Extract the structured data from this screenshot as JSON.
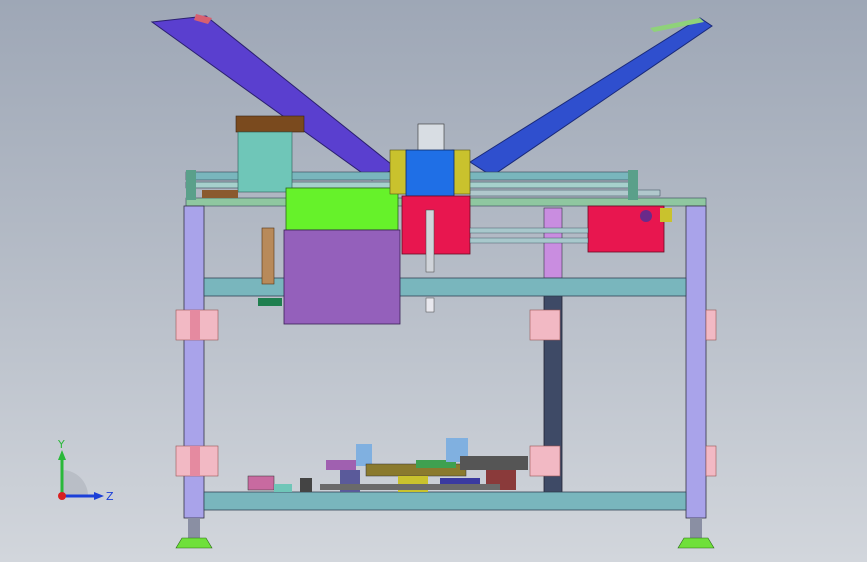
{
  "triad": {
    "y_label": "Y",
    "z_label": "Z"
  },
  "colors": {
    "background_top": "#9ea7b6",
    "background_bottom": "#d2d6dc",
    "frame_post": "#a9a3ea",
    "frame_beam": "#79b6bd",
    "left_arm": "#5a3fcf",
    "right_arm": "#2f4fce",
    "green_block": "#66f22a",
    "purple_box": "#9460bb",
    "red_block": "#e8164f",
    "blue_block": "#1f6fe6",
    "yellow_bracket": "#c9c22d",
    "teal_box": "#6fc6b8",
    "pink_pad": "#f2b9c4",
    "foot_green": "#6fe03a"
  }
}
